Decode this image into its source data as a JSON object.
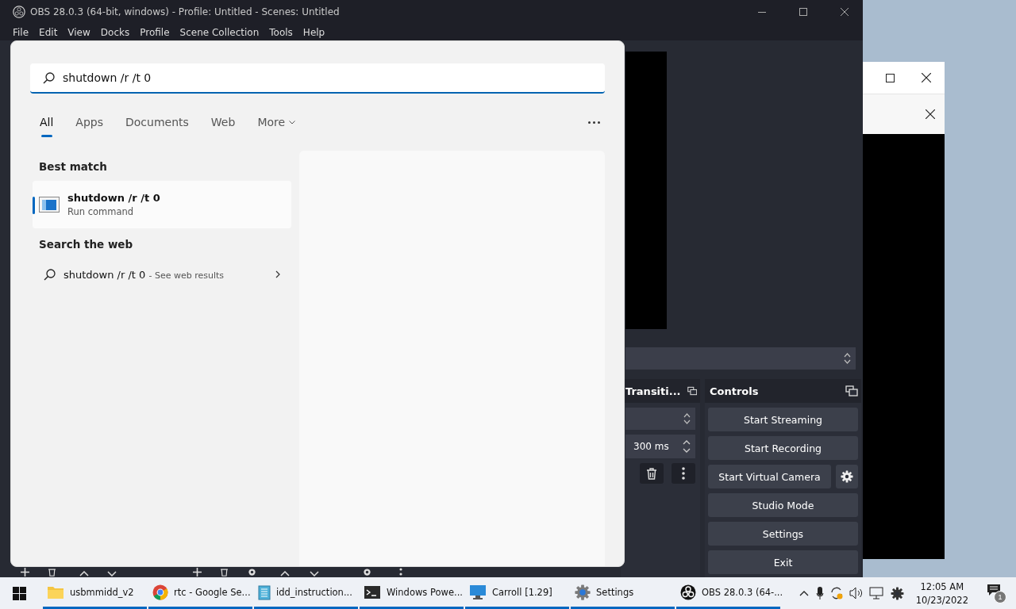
{
  "obs_window": {
    "title": "OBS 28.0.3 (64-bit, windows) - Profile: Untitled - Scenes: Untitled",
    "menu": [
      "File",
      "Edit",
      "View",
      "Docks",
      "Profile",
      "Scene Collection",
      "Tools",
      "Help"
    ],
    "transitions_dock": {
      "title": "Transiti...",
      "duration": "300 ms"
    },
    "controls_dock": {
      "title": "Controls",
      "buttons": [
        {
          "label": "Start Streaming",
          "kind": "button"
        },
        {
          "label": "Start Recording",
          "kind": "button"
        },
        {
          "label": "Start Virtual Camera",
          "kind": "button_with_gear"
        },
        {
          "label": "Studio Mode",
          "kind": "button"
        },
        {
          "label": "Settings",
          "kind": "button"
        },
        {
          "label": "Exit",
          "kind": "button"
        }
      ]
    }
  },
  "search_panel": {
    "query": "shutdown /r /t 0",
    "tabs": [
      {
        "label": "All",
        "selected": true,
        "kind": "tab"
      },
      {
        "label": "Apps",
        "selected": false,
        "kind": "tab"
      },
      {
        "label": "Documents",
        "selected": false,
        "kind": "tab"
      },
      {
        "label": "Web",
        "selected": false,
        "kind": "tab"
      },
      {
        "label": "More",
        "selected": false,
        "kind": "dropdown"
      }
    ],
    "best_match": {
      "heading": "Best match",
      "title": "shutdown /r /t 0",
      "subtitle": "Run command",
      "selected": true
    },
    "web": {
      "heading": "Search the web",
      "query": "shutdown /r /t 0",
      "hint": "- See web results"
    }
  },
  "taskbar": {
    "apps": [
      {
        "label": "usbmmidd_v2",
        "kind": "folder",
        "running": true
      },
      {
        "label": "rtc - Google Se...",
        "kind": "browser",
        "running": true
      },
      {
        "label": "idd_instruction...",
        "kind": "notepad",
        "running": true
      },
      {
        "label": "Windows Powe...",
        "kind": "terminal",
        "running": true
      },
      {
        "label": "Carroll [1.29]",
        "kind": "monitor",
        "running": true
      },
      {
        "label": "Settings",
        "kind": "settings",
        "running": true
      },
      {
        "label": "OBS 28.0.3 (64-...",
        "kind": "recorder",
        "running": true
      }
    ],
    "time": "12:05 AM",
    "date": "10/23/2022",
    "notifications": "1"
  }
}
